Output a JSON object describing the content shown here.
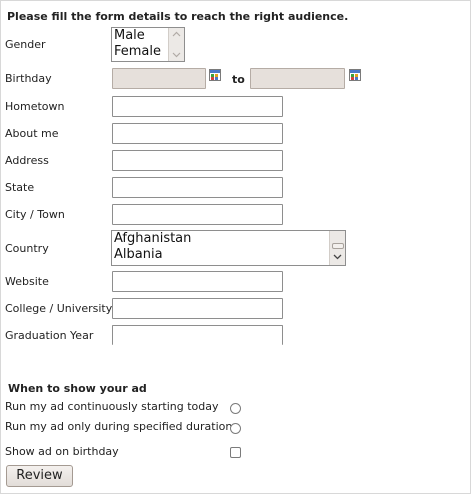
{
  "form": {
    "heading": "Please fill the form details to reach the right audience.",
    "gender": {
      "label": "Gender",
      "options": [
        "Male",
        "Female"
      ]
    },
    "birthday": {
      "label": "Birthday",
      "to_label": "to"
    },
    "hometown": {
      "label": "Hometown"
    },
    "about_me": {
      "label": "About me"
    },
    "address": {
      "label": "Address"
    },
    "state": {
      "label": "State"
    },
    "city": {
      "label": "City / Town"
    },
    "country": {
      "label": "Country",
      "options": [
        "Afghanistan",
        "Albania"
      ]
    },
    "website": {
      "label": "Website"
    },
    "college": {
      "label": "College / University"
    },
    "graduation": {
      "label": "Graduation Year"
    }
  },
  "schedule": {
    "heading": "When to show your ad",
    "option_continuous": "Run my ad continuously starting today",
    "option_duration": "Run my ad only during specified duration",
    "option_birthday": "Show ad on birthday"
  },
  "review_button": "Review",
  "icons": {
    "calendar_from": "calendar-icon",
    "calendar_to": "calendar-icon",
    "scroll_up": "chevron-up-icon",
    "scroll_down": "chevron-down-icon"
  }
}
